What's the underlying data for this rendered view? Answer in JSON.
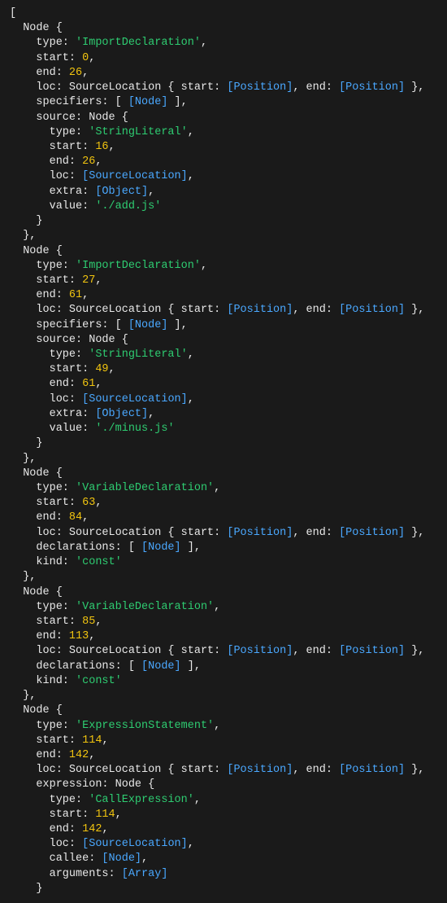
{
  "open": "[",
  "nodes": [
    {
      "header": "  Node {",
      "type_key": "    type: ",
      "type_val": "'ImportDeclaration'",
      "start_key": "    start: ",
      "start_val": "0",
      "end_key": "    end: ",
      "end_val": "26",
      "loc_pre": "    loc: SourceLocation { start: ",
      "loc_pos1": "[Position]",
      "loc_mid": ", end: ",
      "loc_pos2": "[Position]",
      "loc_post": " },",
      "specifiers_pre": "    specifiers: [ ",
      "specifiers_ref": "[Node]",
      "specifiers_post": " ],",
      "source_header": "    source: Node {",
      "src_type_key": "      type: ",
      "src_type_val": "'StringLiteral'",
      "src_start_key": "      start: ",
      "src_start_val": "16",
      "src_end_key": "      end: ",
      "src_end_val": "26",
      "src_loc_key": "      loc: ",
      "src_loc_val": "[SourceLocation]",
      "src_extra_key": "      extra: ",
      "src_extra_val": "[Object]",
      "src_value_key": "      value: ",
      "src_value_val": "'./add.js'",
      "src_close": "    }",
      "close": "  },"
    },
    {
      "header": "  Node {",
      "type_key": "    type: ",
      "type_val": "'ImportDeclaration'",
      "start_key": "    start: ",
      "start_val": "27",
      "end_key": "    end: ",
      "end_val": "61",
      "loc_pre": "    loc: SourceLocation { start: ",
      "loc_pos1": "[Position]",
      "loc_mid": ", end: ",
      "loc_pos2": "[Position]",
      "loc_post": " },",
      "specifiers_pre": "    specifiers: [ ",
      "specifiers_ref": "[Node]",
      "specifiers_post": " ],",
      "source_header": "    source: Node {",
      "src_type_key": "      type: ",
      "src_type_val": "'StringLiteral'",
      "src_start_key": "      start: ",
      "src_start_val": "49",
      "src_end_key": "      end: ",
      "src_end_val": "61",
      "src_loc_key": "      loc: ",
      "src_loc_val": "[SourceLocation]",
      "src_extra_key": "      extra: ",
      "src_extra_val": "[Object]",
      "src_value_key": "      value: ",
      "src_value_val": "'./minus.js'",
      "src_close": "    }",
      "close": "  },"
    },
    {
      "header": "  Node {",
      "type_key": "    type: ",
      "type_val": "'VariableDeclaration'",
      "start_key": "    start: ",
      "start_val": "63",
      "end_key": "    end: ",
      "end_val": "84",
      "loc_pre": "    loc: SourceLocation { start: ",
      "loc_pos1": "[Position]",
      "loc_mid": ", end: ",
      "loc_pos2": "[Position]",
      "loc_post": " },",
      "decl_pre": "    declarations: [ ",
      "decl_ref": "[Node]",
      "decl_post": " ],",
      "kind_key": "    kind: ",
      "kind_val": "'const'",
      "close": "  },"
    },
    {
      "header": "  Node {",
      "type_key": "    type: ",
      "type_val": "'VariableDeclaration'",
      "start_key": "    start: ",
      "start_val": "85",
      "end_key": "    end: ",
      "end_val": "113",
      "loc_pre": "    loc: SourceLocation { start: ",
      "loc_pos1": "[Position]",
      "loc_mid": ", end: ",
      "loc_pos2": "[Position]",
      "loc_post": " },",
      "decl_pre": "    declarations: [ ",
      "decl_ref": "[Node]",
      "decl_post": " ],",
      "kind_key": "    kind: ",
      "kind_val": "'const'",
      "close": "  },"
    },
    {
      "header": "  Node {",
      "type_key": "    type: ",
      "type_val": "'ExpressionStatement'",
      "start_key": "    start: ",
      "start_val": "114",
      "end_key": "    end: ",
      "end_val": "142",
      "loc_pre": "    loc: SourceLocation { start: ",
      "loc_pos1": "[Position]",
      "loc_mid": ", end: ",
      "loc_pos2": "[Position]",
      "loc_post": " },",
      "expr_header": "    expression: Node {",
      "expr_type_key": "      type: ",
      "expr_type_val": "'CallExpression'",
      "expr_start_key": "      start: ",
      "expr_start_val": "114",
      "expr_end_key": "      end: ",
      "expr_end_val": "142",
      "expr_loc_key": "      loc: ",
      "expr_loc_val": "[SourceLocation]",
      "expr_callee_key": "      callee: ",
      "expr_callee_val": "[Node]",
      "expr_args_key": "      arguments: ",
      "expr_args_val": "[Array]",
      "expr_close": "    }"
    }
  ]
}
